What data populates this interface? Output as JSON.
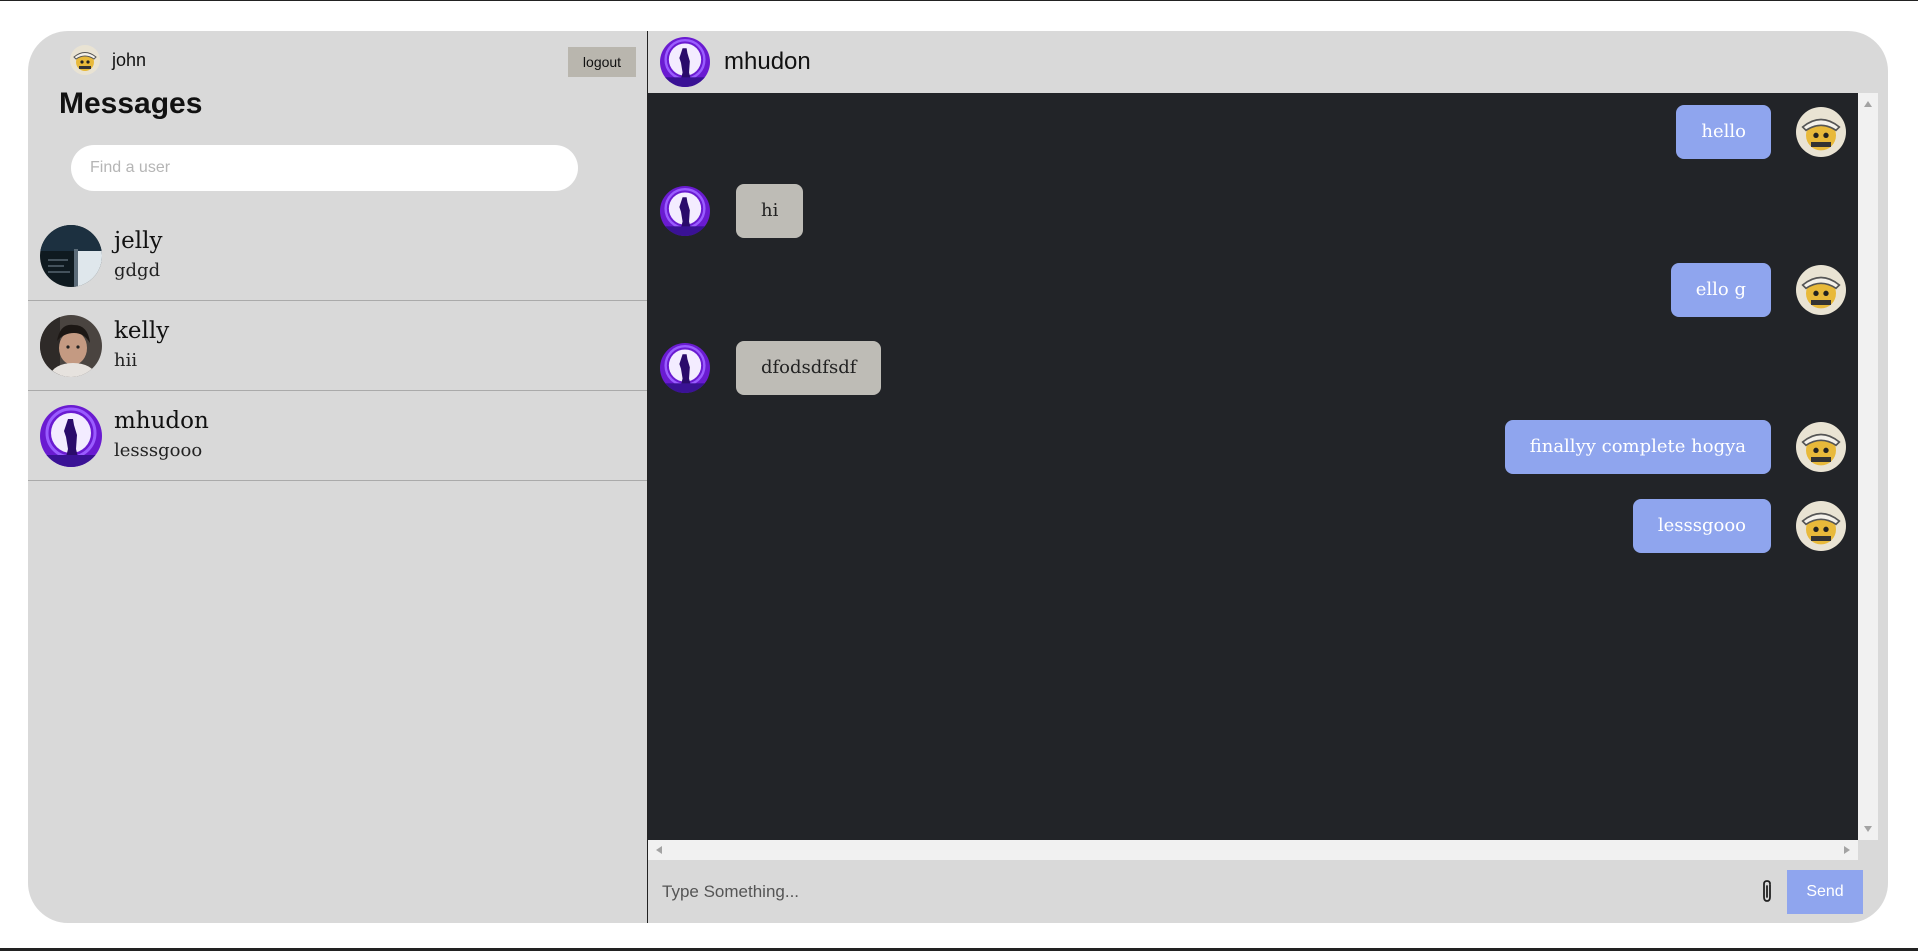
{
  "current_user": {
    "name": "john",
    "avatar_icon": "john-avatar-icon"
  },
  "sidebar": {
    "logout_label": "logout",
    "title": "Messages",
    "search_placeholder": "Find a user",
    "contacts": [
      {
        "name": "jelly",
        "last_message": "gdgd",
        "avatar_icon": "jelly-avatar-icon"
      },
      {
        "name": "kelly",
        "last_message": "hii",
        "avatar_icon": "kelly-avatar-icon"
      },
      {
        "name": "mhudon",
        "last_message": "lesssgooo",
        "avatar_icon": "mhudon-avatar-icon"
      }
    ]
  },
  "chat": {
    "name": "mhudon",
    "messages": [
      {
        "direction": "out",
        "text": "hello"
      },
      {
        "direction": "in",
        "text": "hi"
      },
      {
        "direction": "out",
        "text": "ello g"
      },
      {
        "direction": "in",
        "text": "dfodsdfsdf"
      },
      {
        "direction": "out",
        "text": "finallyy complete hogya"
      },
      {
        "direction": "out",
        "text": "lesssgooo"
      }
    ],
    "composer_placeholder": "Type Something...",
    "send_label": "Send"
  },
  "colors": {
    "panel_bg": "#d9d9d9",
    "chat_bg": "#222428",
    "outgoing_bubble": "#8fa5ee",
    "incoming_bubble": "#bebcb6",
    "accent": "#8fa5ee"
  }
}
